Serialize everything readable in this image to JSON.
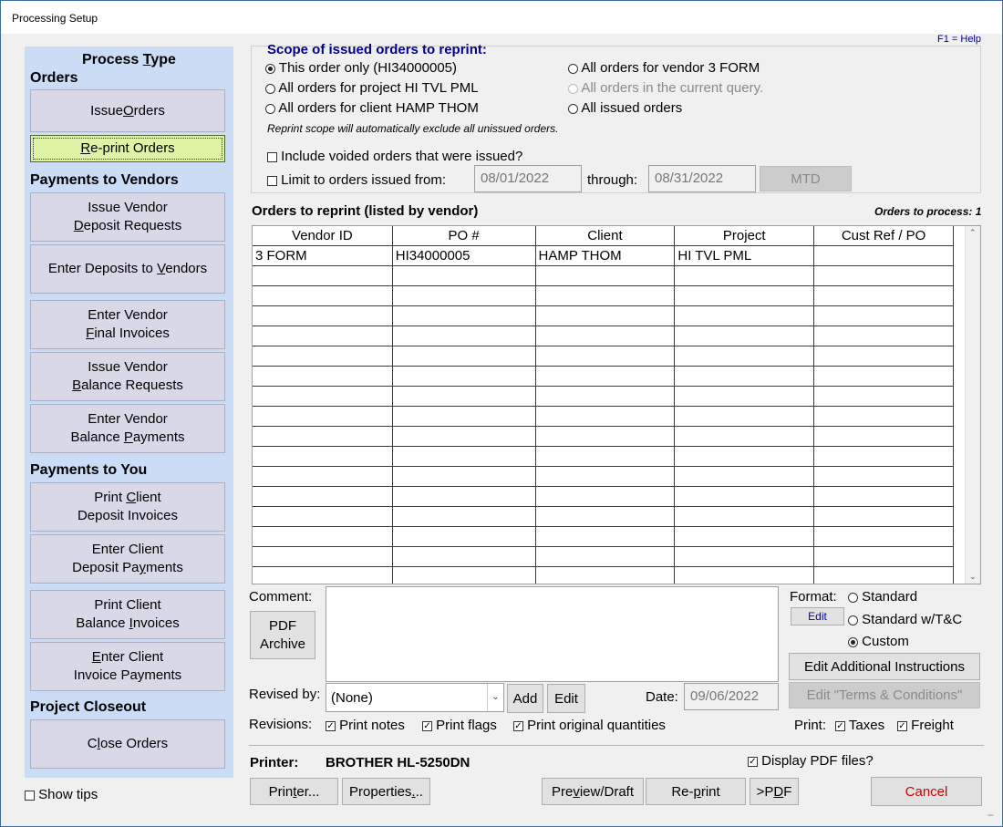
{
  "window": {
    "title": "Processing Setup",
    "help": "F1 = Help"
  },
  "sidebar": {
    "title": "Process Type",
    "orders_heading": "Orders",
    "vendors_heading": "Payments to Vendors",
    "you_heading": "Payments to You",
    "closeout_heading": "Project Closeout",
    "issue_orders": "Issue Orders",
    "reprint_orders": "Re-print Orders",
    "issue_vendor_deposit": [
      "Issue Vendor",
      "Deposit Requests"
    ],
    "enter_deposits_vendors": "Enter Deposits to Vendors",
    "enter_vendor_final": [
      "Enter Vendor",
      "Final Invoices"
    ],
    "issue_vendor_balance": [
      "Issue Vendor",
      "Balance Requests"
    ],
    "enter_vendor_balance": [
      "Enter Vendor",
      "Balance Payments"
    ],
    "print_client_deposit": [
      "Print Client",
      "Deposit Invoices"
    ],
    "enter_client_deposit": [
      "Enter Client",
      "Deposit Payments"
    ],
    "print_client_balance": [
      "Print Client",
      "Balance Invoices"
    ],
    "enter_client_invoice": [
      "Enter Client",
      "Invoice Payments"
    ],
    "close_orders": "Close Orders",
    "show_tips": "Show tips"
  },
  "scope": {
    "heading": "Scope of issued orders to reprint:",
    "this_order": "This order only (HI34000005)",
    "project": "All orders for project HI TVL PML",
    "client": "All orders for client HAMP THOM",
    "vendor": "All orders for vendor 3 FORM",
    "query": "All orders in the current query.",
    "all_issued": "All issued orders",
    "note": "Reprint scope will automatically exclude all unissued orders.",
    "include_voided": "Include voided orders that were issued?",
    "limit_label": "Limit to orders issued from:",
    "from_date": "08/01/2022",
    "through_label": "through:",
    "through_date": "08/31/2022",
    "mtd": "MTD"
  },
  "grid": {
    "title": "Orders to reprint (listed by vendor)",
    "count_label": "Orders to process: 1",
    "columns": [
      "Vendor ID",
      "PO #",
      "Client",
      "Project",
      "Cust Ref / PO"
    ],
    "rows": [
      [
        "3 FORM",
        "HI34000005",
        "HAMP THOM",
        "HI TVL PML",
        ""
      ]
    ]
  },
  "comment": {
    "label": "Comment:",
    "pdf_archive": [
      "PDF",
      "Archive"
    ]
  },
  "format": {
    "label": "Format:",
    "standard": "Standard",
    "standard_tc": "Standard w/T&C",
    "custom": "Custom",
    "edit": "Edit",
    "edit_instructions": "Edit Additional Instructions",
    "edit_terms": "Edit \"Terms & Conditions\""
  },
  "revised": {
    "label": "Revised by:",
    "value": "(None)",
    "add": "Add",
    "edit": "Edit",
    "date_label": "Date:",
    "date": "09/06/2022"
  },
  "revisions": {
    "label": "Revisions:",
    "print_notes": "Print notes",
    "print_flags": "Print flags",
    "print_original": "Print original quantities",
    "print_label": "Print:",
    "taxes": "Taxes",
    "freight": "Freight"
  },
  "printer": {
    "label": "Printer:",
    "name": "BROTHER HL-5250DN",
    "display_pdf": "Display PDF files?",
    "printer_btn": "Printer...",
    "properties_btn": "Properties...",
    "preview_btn": "Preview/Draft",
    "reprint_btn": "Re-print",
    "pdf_btn": ">PDF",
    "cancel_btn": "Cancel"
  },
  "colors": {
    "sidebar_bg": "#cbdcf5",
    "active_button": "#def3a6",
    "heading_blue": "#00008b",
    "cancel_red": "#d40000"
  }
}
